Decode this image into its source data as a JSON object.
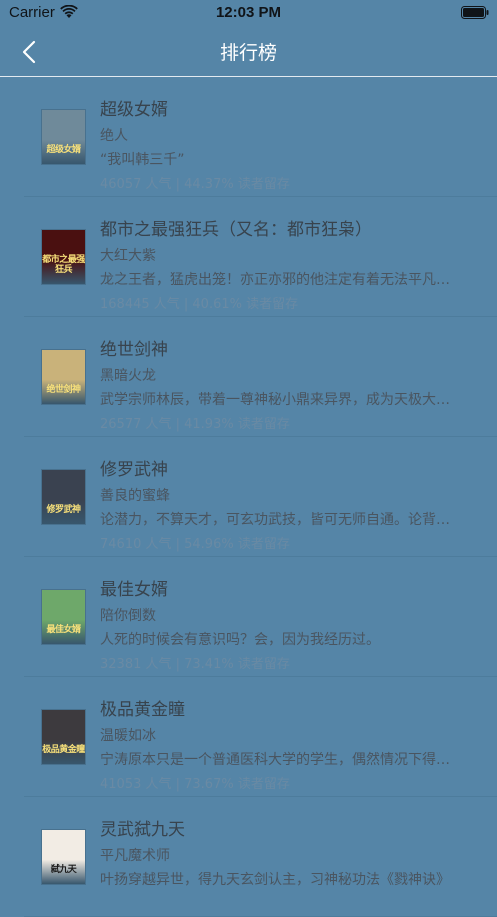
{
  "status_bar": {
    "carrier": "Carrier",
    "time": "12:03 PM"
  },
  "nav": {
    "title": "排行榜"
  },
  "books": [
    {
      "title": "超级女婿",
      "author": "绝人",
      "desc": "“我叫韩三千”",
      "stat": "46057 人气 | 44.37% 读者留存",
      "cover_text": "超级女婿",
      "cover_color": "#6f8a9a"
    },
    {
      "title": "都市之最强狂兵（又名：都市狂枭）",
      "author": "大红大紫",
      "desc": "龙之王者，猛虎出笼！亦正亦邪的他注定有着无法平凡的人生，",
      "stat": "168445 人气 | 40.61% 读者留存",
      "cover_text": "都市之最强狂兵",
      "cover_color": "#4a1010"
    },
    {
      "title": "绝世剑神",
      "author": "黑暗火龙",
      "desc": "武学宗师林辰，带着一尊神秘小鼎来异界，成为天极大陆上的传奇",
      "stat": "26577 人气 | 41.93% 读者留存",
      "cover_text": "绝世剑神",
      "cover_color": "#c9b27a"
    },
    {
      "title": "修罗武神",
      "author": "善良的蜜蜂",
      "desc": "论潜力，不算天才，可玄功武技，皆可无师自通。论背景，",
      "stat": "74610 人气 | 54.96% 读者留存",
      "cover_text": "修罗武神",
      "cover_color": "#3a4250"
    },
    {
      "title": "最佳女婿",
      "author": "陪你倒数",
      "desc": "人死的时候会有意识吗？会，因为我经历过。",
      "stat": "32381 人气 | 73.41% 读者留存",
      "cover_text": "最佳女婿",
      "cover_color": "#6ea86a"
    },
    {
      "title": "极品黄金瞳",
      "author": "温暖如冰",
      "desc": "宁涛原本只是一个普通医科大学的学生，偶然情况下得到一双黄金瞳",
      "stat": "41053 人气 | 73.67% 读者留存",
      "cover_text": "极品黄金瞳",
      "cover_color": "#3d3a3e"
    },
    {
      "title": "灵武弑九天",
      "author": "平凡魔术师",
      "desc": "叶扬穿越异世，得九天玄剑认主，习神秘功法《戮神诀》",
      "stat": "",
      "cover_text": "弑九天",
      "cover_color": "#f2ece4"
    }
  ]
}
